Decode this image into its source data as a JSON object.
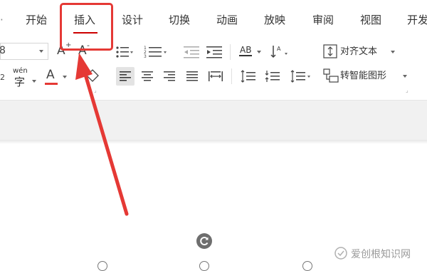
{
  "ribbon": {
    "tabs": [
      {
        "label": "开始"
      },
      {
        "label": "插入"
      },
      {
        "label": "设计"
      },
      {
        "label": "切换"
      },
      {
        "label": "动画"
      },
      {
        "label": "放映"
      },
      {
        "label": "审阅"
      },
      {
        "label": "视图"
      },
      {
        "label": "开发"
      }
    ],
    "active_tab": "插入",
    "font_size_value": "8",
    "phonetic_label": "wén",
    "phonetic_char": "字",
    "align_text_label": "对齐文本",
    "smartart_label": "转智能图形",
    "grow_font_label": "A",
    "shrink_font_label": "A",
    "font_color_label": "A",
    "text_direction_label": "AB",
    "subscript_label": "2"
  },
  "annotation": {
    "highlight_color": "#e53935",
    "arrow_color": "#e53935"
  },
  "watermark": {
    "text": "爱创根知识网"
  }
}
